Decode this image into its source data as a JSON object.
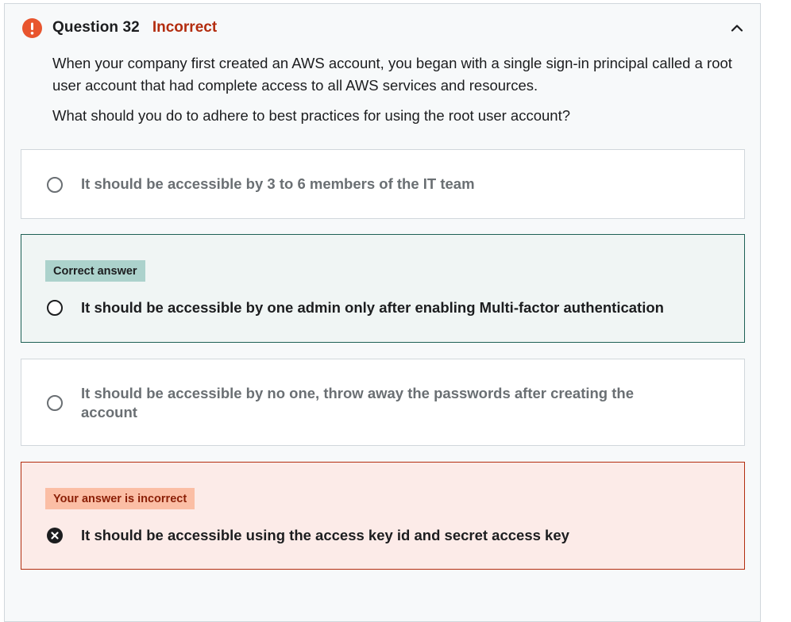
{
  "question": {
    "number_label": "Question 32",
    "status": "Incorrect",
    "icons": {
      "status": "alert-circle-icon",
      "collapse": "chevron-up-icon"
    },
    "text": "When your company first created an AWS account, you began with a single sign-in principal called a root user account that had complete access to all AWS services and resources.",
    "prompt": "What should you do to adhere to best practices for using the root user account?"
  },
  "options": [
    {
      "text": "It should be accessible by 3 to 6 members of the IT team",
      "state": "unselected"
    },
    {
      "badge": "Correct answer",
      "text": "It should be accessible by one admin only after enabling Multi-factor authentication",
      "state": "correct"
    },
    {
      "text": "It should be accessible by no one, throw away the passwords after creating the account",
      "state": "unselected"
    },
    {
      "badge": "Your answer is incorrect",
      "text": "It should be accessible using the access key id and secret access key",
      "state": "selected-incorrect",
      "icon": "x-circle-icon"
    }
  ],
  "colors": {
    "incorrect": "#b32d0f",
    "alert_icon": "#e8552e",
    "correct_border": "#1e6055",
    "correct_badge": "#acd2cc",
    "incorrect_badge": "#fbbea5",
    "incorrect_bg": "#fcebe8",
    "correct_bg": "#f0f5f4"
  }
}
